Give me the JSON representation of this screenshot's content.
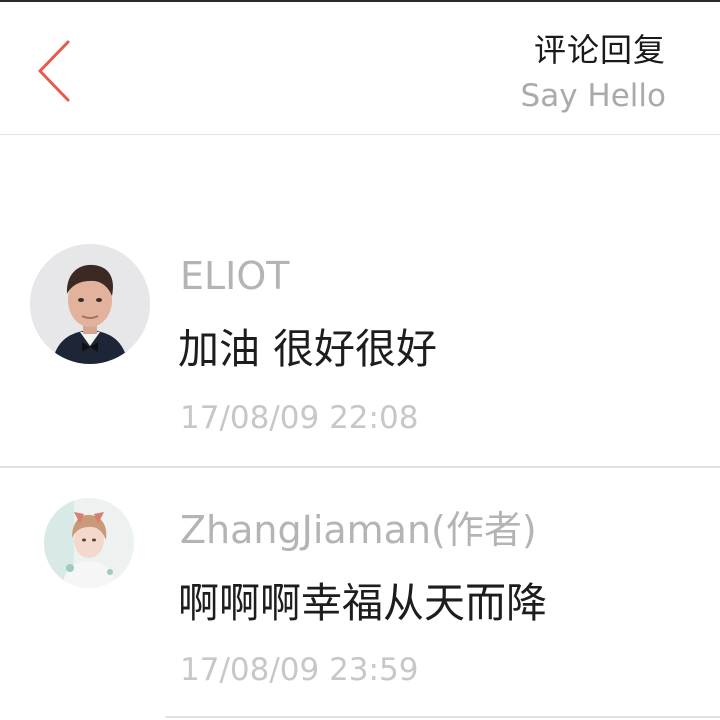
{
  "header": {
    "back_icon": "chevron-left-icon",
    "title": "评论回复",
    "subtitle": "Say Hello",
    "accent_color": "#e8594a"
  },
  "comments": [
    {
      "author": "ELIOT",
      "content": "加油 很好很好",
      "time": "17/08/09 22:08",
      "avatar": "user-avatar-photo"
    },
    {
      "author": "ZhangJiaman(作者)",
      "content": "啊啊啊幸福从天而降",
      "time": "17/08/09 23:59",
      "avatar": "user-avatar-photo"
    }
  ]
}
